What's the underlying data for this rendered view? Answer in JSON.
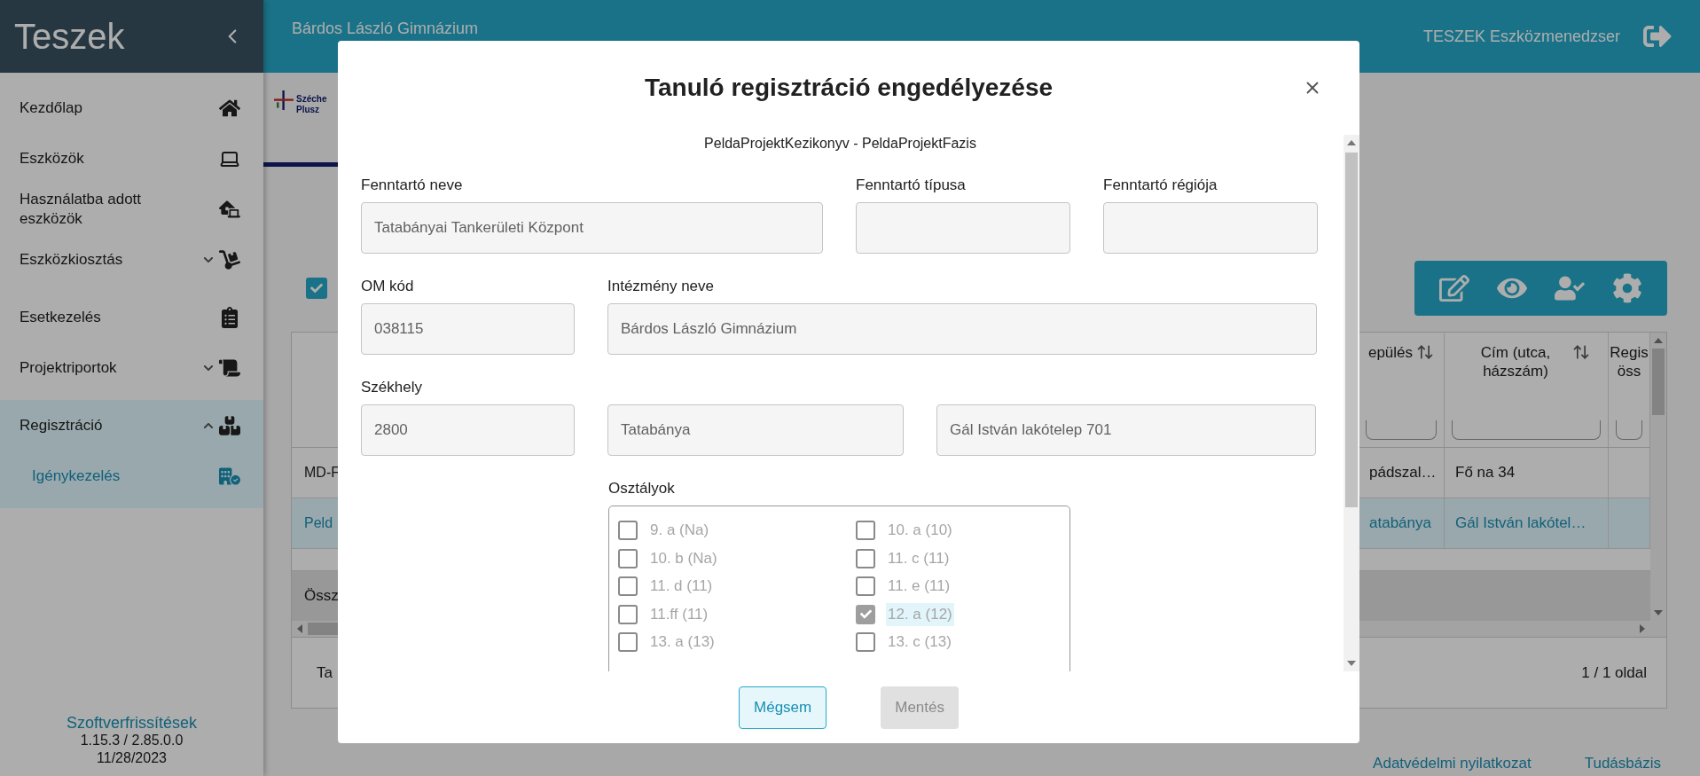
{
  "sidebar": {
    "title": "Teszek",
    "items": [
      {
        "label": "Kezdőlap",
        "selected": false
      },
      {
        "label": "Eszközök",
        "selected": false
      },
      {
        "label": "Használatba adott eszközök",
        "selected": false
      },
      {
        "label": "Eszközkiosztás",
        "selected": false,
        "expanded": false
      },
      {
        "label": "Esetkezelés",
        "selected": false
      },
      {
        "label": "Projektriportok",
        "selected": false,
        "expanded": false
      },
      {
        "label": "Regisztráció",
        "selected": false,
        "expanded": true,
        "children": [
          {
            "label": "Igénykezelés",
            "selected": true
          }
        ]
      }
    ],
    "footer": {
      "link": "Szoftverfrissítések",
      "version": "1.15.3 / 2.85.0.0",
      "date": "11/28/2023"
    }
  },
  "header": {
    "institution": "Bárdos László Gimnázium",
    "app_name": "TESZEK Eszközmenedzser"
  },
  "logo": {
    "line_1": "Széche",
    "line_2": "Plusz"
  },
  "filter_checkbox": {
    "checked": true
  },
  "table": {
    "columns": [
      {
        "label": "epülés",
        "sortable": true
      },
      {
        "label": "Cím (utca, házszám)",
        "sortable": true
      },
      {
        "label": "Regis öss",
        "sortable": false
      }
    ],
    "rows": [
      {
        "lead": "MD-F",
        "cells": [
          "pádszal…",
          "Fő na 34"
        ],
        "selected": false
      },
      {
        "lead": "Peld",
        "cells": [
          "atabánya",
          "Gál István lakótel…"
        ],
        "selected": true
      }
    ],
    "summary": "Össz",
    "footer_left": "Ta",
    "pages": "1 / 1 oldal"
  },
  "footer_links": [
    "Adatvédelmi nyilatkozat",
    "Tudásbázis"
  ],
  "dialog": {
    "title": "Tanuló regisztráció engedélyezése",
    "subtitle": "PeldaProjektKezikonyv - PeldaProjektFazis",
    "rows": [
      [
        {
          "label": "Fenntartó neve",
          "value": "Tatabányai Tankerületi Központ"
        },
        {
          "label": "Fenntartó típusa"
        },
        {
          "label": "Fenntartó régiója"
        }
      ],
      [
        {
          "label": "OM kód",
          "value": "038115"
        },
        {
          "label": "Intézmény neve",
          "value": "Bárdos László Gimnázium"
        }
      ],
      [
        {
          "label": "Székhely",
          "value": "2800"
        },
        {
          "value": "Tatabánya"
        },
        {
          "value": "Gál István lakótelep 701"
        }
      ]
    ],
    "classes": {
      "label": "Osztályok",
      "disabled": true,
      "items": [
        {
          "label": "9. a (Na)",
          "checked": false
        },
        {
          "label": "10. a (10)",
          "checked": false
        },
        {
          "label": "10. b (Na)",
          "checked": false
        },
        {
          "label": "11. c (11)",
          "checked": false
        },
        {
          "label": "11. d (11)",
          "checked": false
        },
        {
          "label": "11. e (11)",
          "checked": false
        },
        {
          "label": "11.ff (11)",
          "checked": false
        },
        {
          "label": "12. a (12)",
          "checked": true
        },
        {
          "label": "13. a (13)",
          "checked": false
        },
        {
          "label": "13. c (13)",
          "checked": false
        }
      ]
    },
    "buttons": [
      {
        "label": "Mégsem",
        "kind": "secondary",
        "disabled": false
      },
      {
        "label": "Mentés",
        "kind": "primary",
        "disabled": true
      }
    ]
  }
}
